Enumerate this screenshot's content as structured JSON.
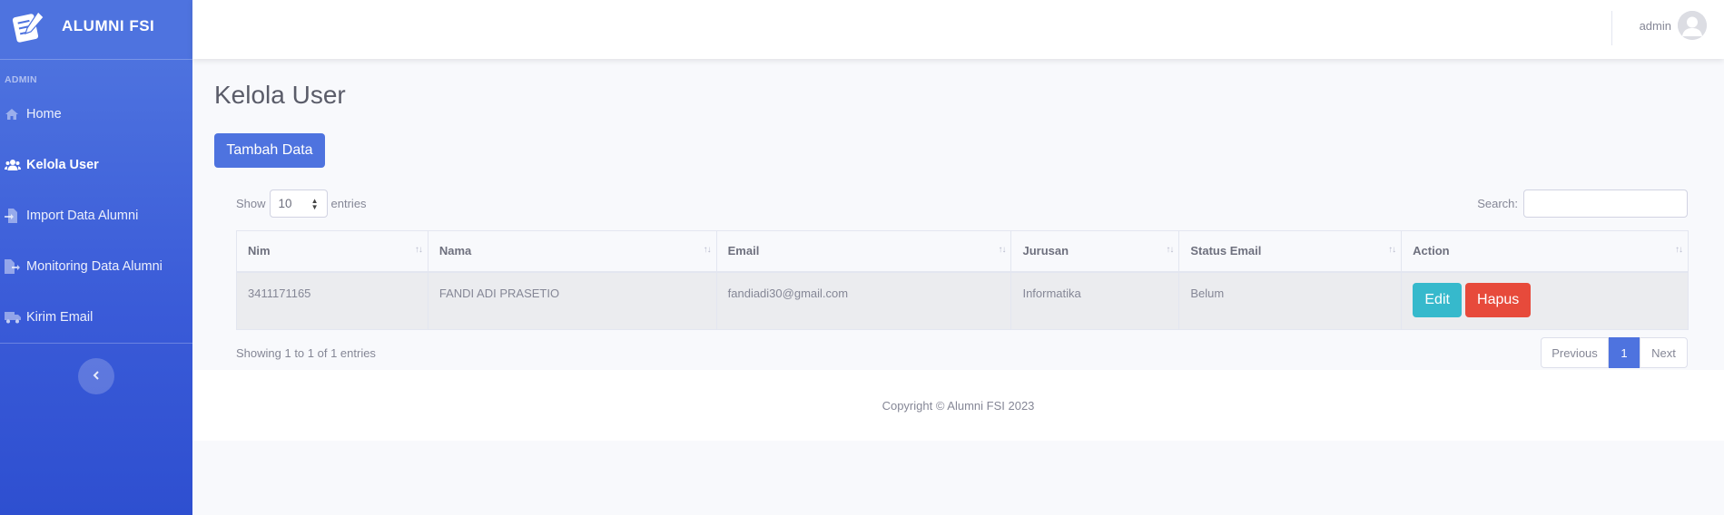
{
  "brand": {
    "name": "ALUMNI FSI",
    "logo_icon": "notebook-pen-logo-icon"
  },
  "sidebar": {
    "heading": "ADMIN",
    "items": [
      {
        "label": "Home",
        "icon": "home-icon",
        "active": false
      },
      {
        "label": "Kelola User",
        "icon": "users-icon",
        "active": true
      },
      {
        "label": "Import Data Alumni",
        "icon": "file-import-icon",
        "active": false
      },
      {
        "label": "Monitoring Data Alumni",
        "icon": "file-export-icon",
        "active": false
      },
      {
        "label": "Kirim Email",
        "icon": "truck-icon",
        "active": false
      }
    ],
    "toggle_icon": "chevron-left-icon"
  },
  "topbar": {
    "user_name": "admin"
  },
  "page": {
    "title": "Kelola User",
    "add_button": "Tambah Data"
  },
  "datatable": {
    "show_label": "Show",
    "entries_value": "10",
    "entries_label": "entries",
    "search_label": "Search:",
    "search_value": "",
    "columns": [
      "Nim",
      "Nama",
      "Email",
      "Jurusan",
      "Status Email",
      "Action"
    ],
    "rows": [
      {
        "nim": "3411171165",
        "nama": "FANDI ADI PRASETIO",
        "email": "fandiadi30@gmail.com",
        "jurusan": "Informatika",
        "status_email": "Belum",
        "edit_label": "Edit",
        "delete_label": "Hapus"
      }
    ],
    "info": "Showing 1 to 1 of 1 entries",
    "pagination": {
      "previous": "Previous",
      "current": "1",
      "next": "Next"
    }
  },
  "footer": {
    "text": "Copyright © Alumni FSI 2023"
  },
  "colors": {
    "primary": "#4e73df",
    "info": "#36b9cc",
    "danger": "#e74a3b"
  }
}
